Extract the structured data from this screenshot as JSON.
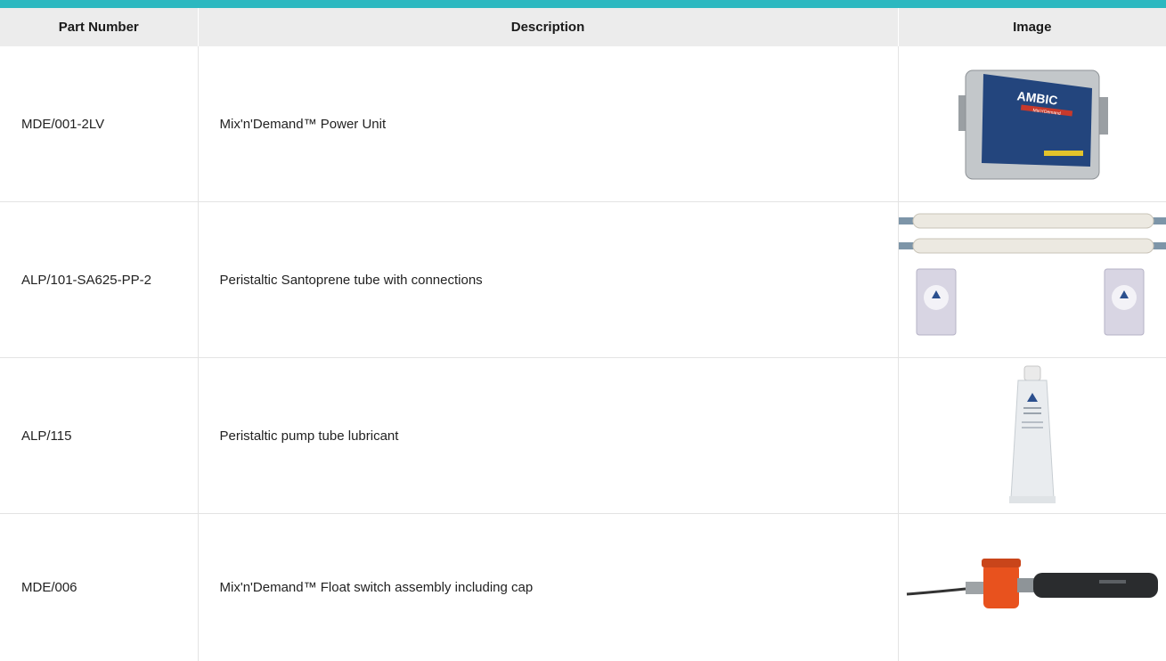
{
  "table": {
    "headers": {
      "part_number": "Part Number",
      "description": "Description",
      "image": "Image"
    },
    "rows": [
      {
        "part_number": "MDE/001-2LV",
        "description": "Mix'n'Demand™ Power Unit",
        "image_icon": "power-unit-image",
        "image_text": [
          "AMBIC",
          "Mix'n'Demand"
        ]
      },
      {
        "part_number": "ALP/101-SA625-PP-2",
        "description": "Peristaltic Santoprene tube with connections",
        "image_icon": "santoprene-tube-image"
      },
      {
        "part_number": "ALP/115",
        "description": "Peristaltic pump tube lubricant",
        "image_icon": "lubricant-tube-image"
      },
      {
        "part_number": "MDE/006",
        "description": "Mix'n'Demand™ Float switch assembly including cap",
        "image_icon": "float-switch-image"
      }
    ]
  },
  "colors": {
    "accent": "#2cb8c0",
    "header_bg": "#ececec",
    "unit_label": "#1f4a9a",
    "cap": "#e8521e"
  }
}
